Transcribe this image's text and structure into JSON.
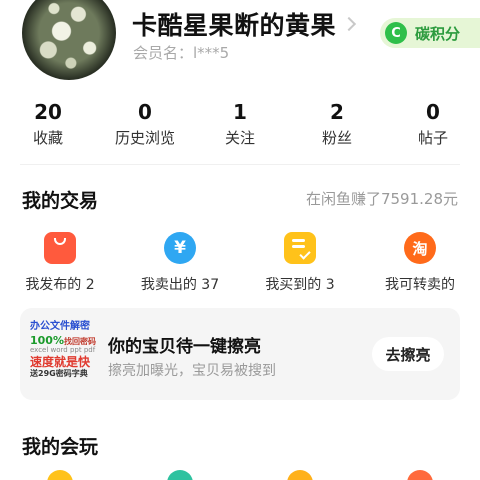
{
  "profile": {
    "nickname": "卡酷星果断的黄果",
    "member_label": "会员名：l***5",
    "carbon_button": {
      "icon_letter": "C",
      "label": "碳积分",
      "color": "#2fbf4a"
    }
  },
  "stats": [
    {
      "value": "20",
      "label": "收藏"
    },
    {
      "value": "0",
      "label": "历史浏览"
    },
    {
      "value": "1",
      "label": "关注"
    },
    {
      "value": "2",
      "label": "粉丝"
    },
    {
      "value": "0",
      "label": "帖子"
    }
  ],
  "trades": {
    "title": "我的交易",
    "earned": "在闲鱼赚了7591.28元",
    "items": [
      {
        "icon": "shopping-bag-icon",
        "label": "我发布的 2",
        "color": "#ff5a3d"
      },
      {
        "icon": "yen-icon",
        "label": "我卖出的 37",
        "color": "#2fa7f2"
      },
      {
        "icon": "order-check-icon",
        "label": "我买到的 3",
        "color": "#ffc21a"
      },
      {
        "icon": "taobao-icon",
        "icon_text": "淘",
        "label": "我可转卖的",
        "color": "#ff6a1a"
      }
    ]
  },
  "promo": {
    "image_lines": [
      "办公文件解密",
      "100%",
      "找回密码",
      "excel word ppt pdf",
      "速度就是快",
      "送29G密码字典"
    ],
    "title": "你的宝贝待一键擦亮",
    "subtitle": "擦亮加曝光，宝贝易被搜到",
    "button": "去擦亮"
  },
  "play": {
    "title": "我的会玩"
  }
}
